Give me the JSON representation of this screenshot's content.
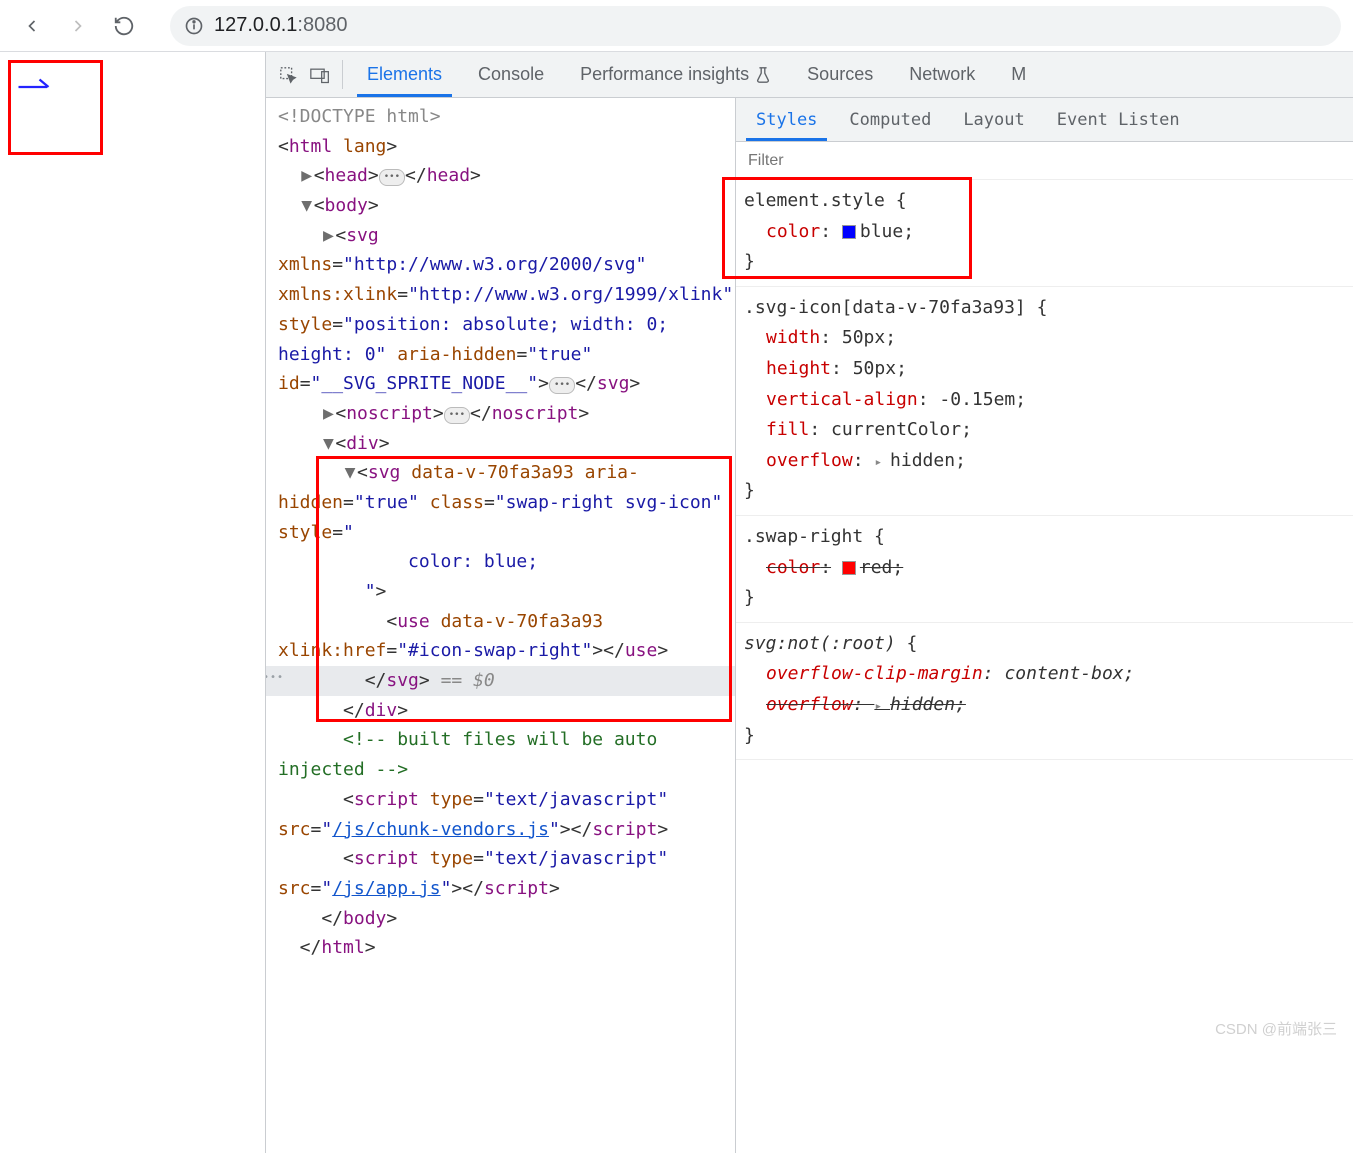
{
  "browser": {
    "url_host": "127.0.0.1",
    "url_port": ":8080"
  },
  "devtools_tabs": [
    "Elements",
    "Console",
    "Performance insights",
    "Sources",
    "Network",
    "M"
  ],
  "devtools_active": "Elements",
  "styles_tabs": [
    "Styles",
    "Computed",
    "Layout",
    "Event Listen"
  ],
  "styles_active": "Styles",
  "filter_placeholder": "Filter",
  "element_tree": {
    "doctype": "<!DOCTYPE html>",
    "html_open": "html",
    "html_open_attr": "lang",
    "head": "head",
    "body": "body",
    "svg_sprite": {
      "tag": "svg",
      "attrs": "xmlns=\"http://www.w3.org/2000/svg\" xmlns:xlink=\"http://www.w3.org/1999/xlink\" style=\"position: absolute; width: 0; height: 0\" aria-hidden=\"true\" id=\"__SVG_SPRITE_NODE__\""
    },
    "noscript": "noscript",
    "div": "div",
    "svg_sel": {
      "open": "svg",
      "data": "data-v-70fa3a93",
      "aria": "aria-hidden=\"true\"",
      "class_attr": "swap-right svg-icon",
      "style_indent": "    color: blue;"
    },
    "use": {
      "tag": "use",
      "data": "data-v-70fa3a93",
      "href": "#icon-swap-right"
    },
    "eq": "== $0",
    "comment": "<!-- built files will be auto injected -->",
    "script1": {
      "attrs": "type=\"text/javascript\" src=",
      "src": "/js/chunk-vendors.js"
    },
    "script2": {
      "attrs": "type=\"text/javascript\" src=",
      "src": "/js/app.js"
    }
  },
  "styles_rules": {
    "element_style": {
      "selector": "element.style",
      "prop": "color",
      "val": "blue",
      "swatch": "#0000ff"
    },
    "svg_icon": {
      "selector": ".svg-icon[data-v-70fa3a93]",
      "p1": "width",
      "v1": "50px",
      "p2": "height",
      "v2": "50px",
      "p3": "vertical-align",
      "v3": "-0.15em",
      "p4": "fill",
      "v4": "currentColor",
      "p5": "overflow",
      "v5": "hidden"
    },
    "swap_right": {
      "selector": ".swap-right",
      "prop": "color",
      "val": "red",
      "swatch": "#ff0000"
    },
    "svg_not_root": {
      "selector": "svg:not(:root)",
      "p1": "overflow-clip-margin",
      "v1": "content-box",
      "p2": "overflow",
      "v2": "hidden"
    }
  },
  "watermark": "CSDN @前端张三"
}
